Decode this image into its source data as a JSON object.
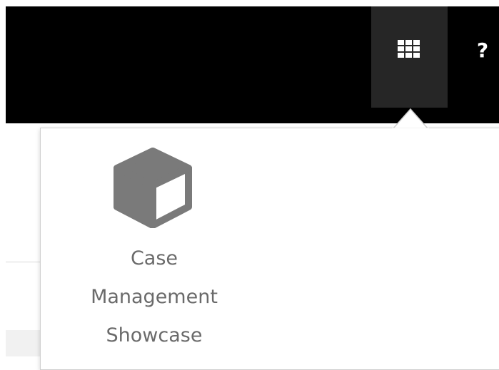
{
  "navbar": {
    "apps_icon": "grid-icon",
    "help_label": "?"
  },
  "apps_popover": {
    "apps": [
      {
        "icon": "cube-icon",
        "label": "Case Management Showcase"
      }
    ]
  },
  "colors": {
    "navbar_bg": "#000000",
    "apps_toggle_active_bg": "#262626",
    "icon_gray": "#7a7a7a",
    "label_gray": "#6a6a6a"
  }
}
